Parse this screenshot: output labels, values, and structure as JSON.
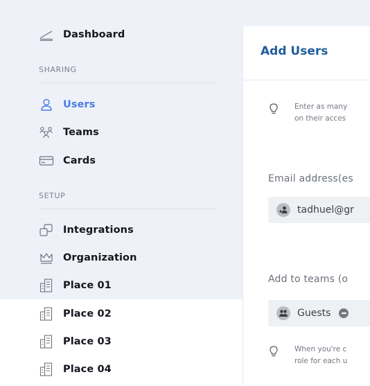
{
  "sidebar": {
    "top_item": {
      "label": "Dashboard",
      "icon": "chart-line-icon"
    },
    "sections": [
      {
        "title": "SHARING",
        "items": [
          {
            "label": "Users",
            "icon": "user-icon",
            "active": true
          },
          {
            "label": "Teams",
            "icon": "team-icon",
            "active": false
          },
          {
            "label": "Cards",
            "icon": "card-icon",
            "active": false
          }
        ]
      },
      {
        "title": "SETUP",
        "items": [
          {
            "label": "Integrations",
            "icon": "integrations-icon"
          },
          {
            "label": "Organization",
            "icon": "crown-icon"
          },
          {
            "label": "Place 01",
            "icon": "building-icon"
          },
          {
            "label": "Place 02",
            "icon": "building-icon"
          },
          {
            "label": "Place 03",
            "icon": "building-icon"
          },
          {
            "label": "Place 04",
            "icon": "building-icon"
          }
        ]
      }
    ]
  },
  "main": {
    "title": "Add Users",
    "hint_top": {
      "line1": "Enter as many",
      "line2": "on their acces"
    },
    "email": {
      "label": "Email address(es",
      "value": "tadhuel@gr"
    },
    "teams": {
      "label": "Add to teams (o",
      "chip": "Guests"
    },
    "hint_bottom": {
      "line1": "When you're c",
      "line2": "role for each u"
    }
  },
  "colors": {
    "accent": "#4b7be5",
    "title": "#1f5c9e",
    "background": "#eef2f8"
  }
}
